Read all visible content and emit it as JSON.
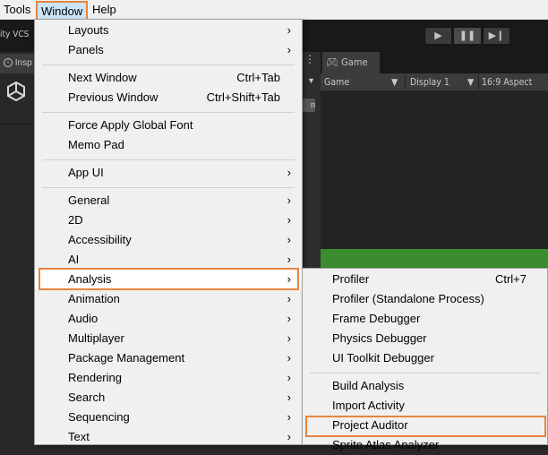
{
  "menubar": {
    "tools": "Tools",
    "window": "Window",
    "help": "Help"
  },
  "editor": {
    "vcs_label": "ity VCS",
    "inspector_tab": "Insp",
    "game_tab": "Game",
    "game_toolbar": {
      "view": "Game",
      "display": "Display 1",
      "aspect": "16:9 Aspect"
    },
    "play_icons": [
      "play-icon",
      "pause-icon",
      "step-icon"
    ],
    "mid_button": "n"
  },
  "window_menu": {
    "items": [
      {
        "label": "Layouts",
        "submenu": true
      },
      {
        "label": "Panels",
        "submenu": true
      },
      {
        "label": "Next Window",
        "shortcut": "Ctrl+Tab"
      },
      {
        "label": "Previous Window",
        "shortcut": "Ctrl+Shift+Tab"
      },
      {
        "label": "Force Apply Global Font"
      },
      {
        "label": "Memo Pad"
      },
      {
        "label": "App UI",
        "submenu": true
      },
      {
        "label": "General",
        "submenu": true
      },
      {
        "label": "2D",
        "submenu": true
      },
      {
        "label": "Accessibility",
        "submenu": true
      },
      {
        "label": "AI",
        "submenu": true
      },
      {
        "label": "Analysis",
        "submenu": true,
        "highlighted": true
      },
      {
        "label": "Animation",
        "submenu": true
      },
      {
        "label": "Audio",
        "submenu": true
      },
      {
        "label": "Multiplayer",
        "submenu": true
      },
      {
        "label": "Package Management",
        "submenu": true
      },
      {
        "label": "Rendering",
        "submenu": true
      },
      {
        "label": "Search",
        "submenu": true
      },
      {
        "label": "Sequencing",
        "submenu": true
      },
      {
        "label": "Text",
        "submenu": true
      }
    ]
  },
  "analysis_menu": {
    "items": [
      {
        "label": "Profiler",
        "shortcut": "Ctrl+7"
      },
      {
        "label": "Profiler (Standalone Process)"
      },
      {
        "label": "Frame Debugger"
      },
      {
        "label": "Physics Debugger"
      },
      {
        "label": "UI Toolkit Debugger"
      },
      {
        "label": "Build Analysis"
      },
      {
        "label": "Import Activity"
      },
      {
        "label": "Project Auditor",
        "highlighted": true
      },
      {
        "label": "Sprite Atlas Analyzer"
      }
    ]
  },
  "colors": {
    "highlight_border": "#e8843f",
    "menu_bg": "#f0f0f0",
    "editor_bg": "#282828",
    "game_green": "#3b8c2f"
  }
}
